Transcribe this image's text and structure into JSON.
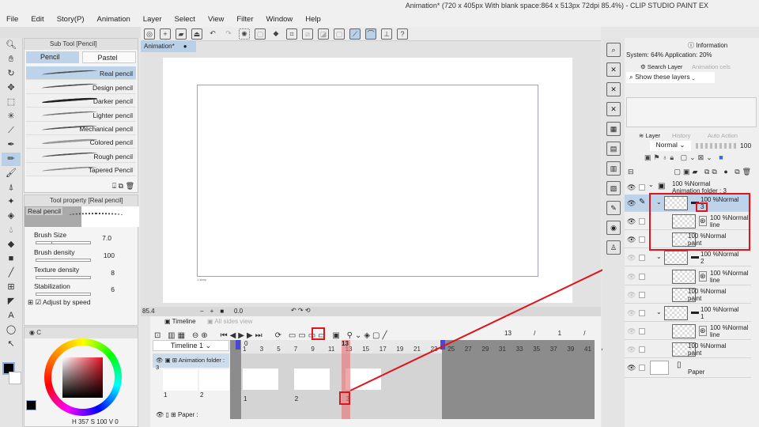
{
  "window": {
    "title": "Animation* (720 x 405px With blank space:864 x 513px 72dpi 85.4%) - CLIP STUDIO PAINT EX"
  },
  "menu": [
    "File",
    "Edit",
    "Story(P)",
    "Animation",
    "Layer",
    "Select",
    "View",
    "Filter",
    "Window",
    "Help"
  ],
  "toolbar_icons": [
    "canvas-icon",
    "new-icon",
    "open-icon",
    "save-icon",
    "undo-icon",
    "redo-icon",
    "deselect-icon",
    "crop-icon",
    "fill-icon",
    "transform-icon",
    "ruler-hide-icon",
    "ruler-icon",
    "frame-icon",
    "snap-ruler-icon",
    "snap-special-icon",
    "snap-grid-icon",
    "help-icon"
  ],
  "tools": [
    "zoom",
    "hand",
    "rotate",
    "move",
    "select",
    "auto-select",
    "eyedropper",
    "pen",
    "pencil",
    "brush",
    "airbrush",
    "decoration",
    "eraser",
    "blend",
    "fill",
    "gradient",
    "figure",
    "frame",
    "text",
    "balloon",
    "correct-line"
  ],
  "subtool": {
    "tab": "Sub Tool [Pencil]",
    "groups": [
      "Pencil",
      "Pastel"
    ],
    "items": [
      "Real pencil",
      "Design pencil",
      "Darker pencil",
      "Lighter pencil",
      "Mechanical pencil",
      "Colored pencil",
      "Rough pencil",
      "Tapered Pencil"
    ],
    "selected": 0
  },
  "toolprop": {
    "tab": "Tool property [Real pencil]",
    "name": "Real pencil",
    "props": [
      {
        "label": "Brush Size",
        "value": "7.0",
        "fill": 0.3
      },
      {
        "label": "Brush density",
        "value": "100",
        "fill": 1.0
      },
      {
        "label": "Texture density",
        "value": "8",
        "fill": 0.08
      },
      {
        "label": "Stabilization",
        "value": "6",
        "fill": 0.35
      }
    ],
    "adjust": "Adjust by speed"
  },
  "color": {
    "h": "357",
    "s": "100",
    "v": "0",
    "main": "#000000",
    "sub": "#ffffff",
    "tab": "C"
  },
  "document": {
    "tab": "Animation*",
    "frame_label": "1 story"
  },
  "status": {
    "zoom": "85.4",
    "angle": "0.0"
  },
  "timeline": {
    "tab": "Timeline",
    "tab2": "All sides view",
    "name": "Timeline 1",
    "current": "13",
    "start": "1",
    "end": "24",
    "ruler": [
      "1",
      "3",
      "5",
      "7",
      "9",
      "11",
      "13",
      "15",
      "17",
      "19",
      "21",
      "23",
      "25",
      "27",
      "29",
      "31",
      "33",
      "35",
      "37",
      "39",
      "41",
      "43"
    ],
    "folder": "Animation folder : 3",
    "paper": "Paper :",
    "cels": [
      {
        "frame": 1,
        "label": "1"
      },
      {
        "frame": 7,
        "label": "2"
      },
      {
        "frame": 13,
        "label": "3"
      }
    ],
    "thumb_labels": [
      "1",
      "2"
    ],
    "zero": "0"
  },
  "info": {
    "tab": "Information",
    "text": "System: 64% Application: 20%"
  },
  "search": {
    "tab": "Search Layer",
    "tab2": "Animation cels",
    "filter": "Show these layers"
  },
  "layers": {
    "tab": "Layer",
    "tab2": "History",
    "tab3": "Auto Action",
    "blend": "Normal",
    "opacity": "100",
    "rows": [
      {
        "pct": "100 %Normal",
        "name": "Animation folder : 3"
      },
      {
        "pct": "100 %Normal",
        "name": "3"
      },
      {
        "pct": "100 %Normal",
        "name": "line"
      },
      {
        "pct": "100 %Normal",
        "name": "paint"
      },
      {
        "pct": "100 %Normal",
        "name": "2"
      },
      {
        "pct": "100 %Normal",
        "name": "line"
      },
      {
        "pct": "100 %Normal",
        "name": "paint"
      },
      {
        "pct": "100 %Normal",
        "name": "1"
      },
      {
        "pct": "100 %Normal",
        "name": "line"
      },
      {
        "pct": "100 %Normal",
        "name": "paint"
      },
      {
        "pct": "",
        "name": "Paper"
      }
    ]
  },
  "colors": {
    "accent": "#b8d0e8",
    "highlight": "#e0141c",
    "playhead": "#e88a8a"
  }
}
